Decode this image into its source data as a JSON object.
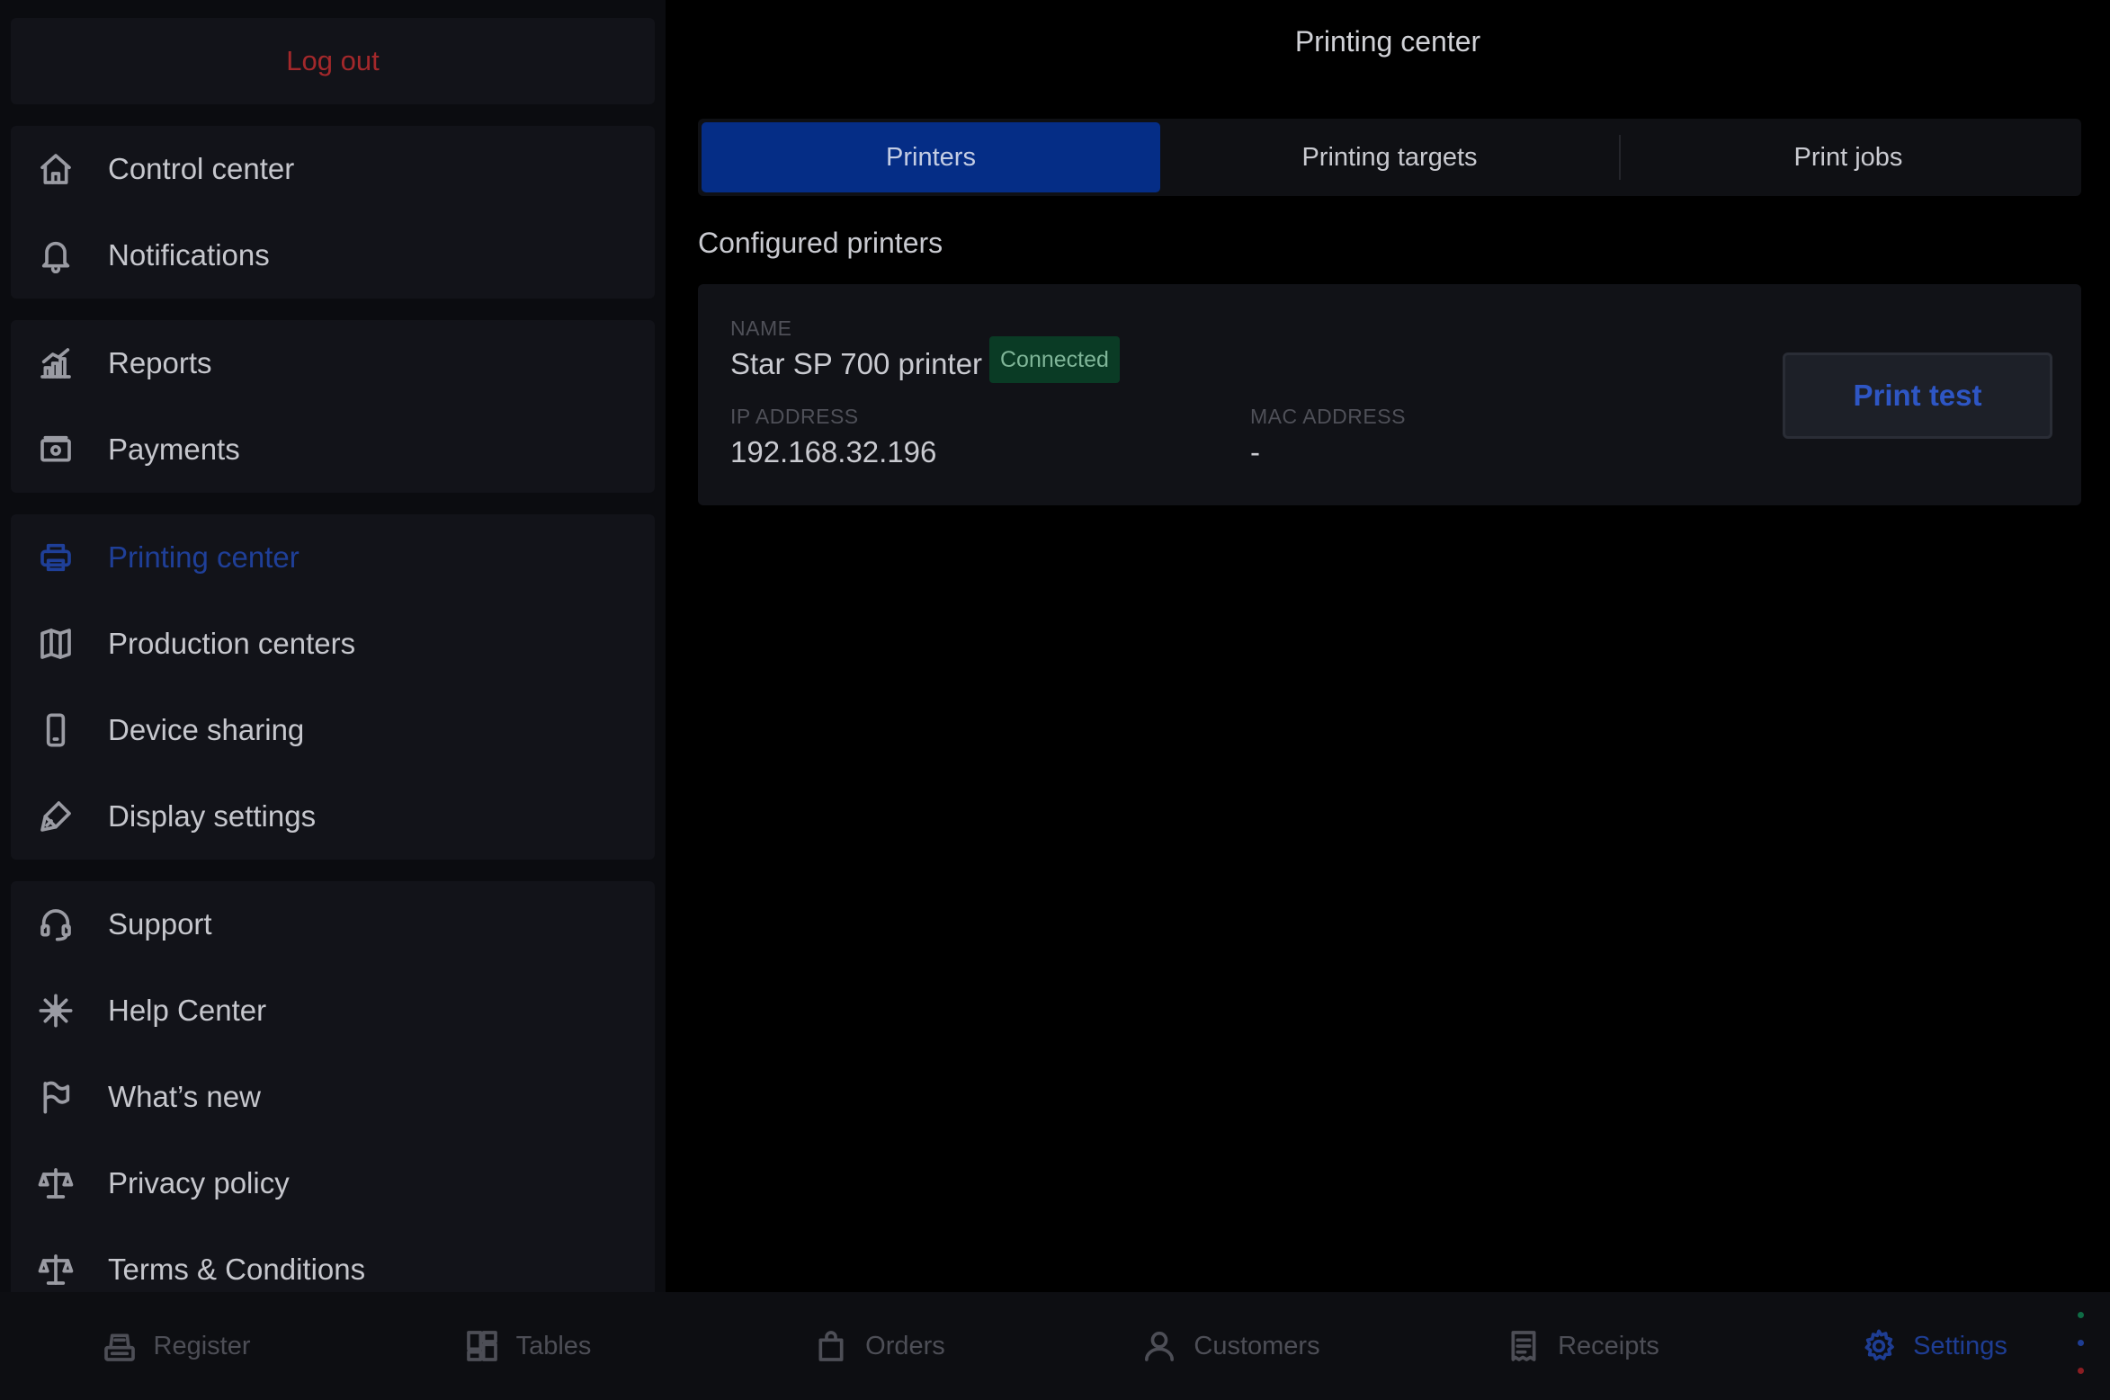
{
  "sidebar": {
    "logout_label": "Log out",
    "group1": [
      {
        "label": "Control center",
        "icon": "home-icon"
      },
      {
        "label": "Notifications",
        "icon": "bell-icon"
      }
    ],
    "group2": [
      {
        "label": "Reports",
        "icon": "chart-icon"
      },
      {
        "label": "Payments",
        "icon": "cash-icon"
      }
    ],
    "group3": [
      {
        "label": "Printing center",
        "icon": "printer-icon",
        "active": true
      },
      {
        "label": "Production centers",
        "icon": "map-icon"
      },
      {
        "label": "Device sharing",
        "icon": "phone-icon"
      },
      {
        "label": "Display settings",
        "icon": "brush-icon"
      }
    ],
    "group4": [
      {
        "label": "Support",
        "icon": "headset-icon"
      },
      {
        "label": "Help Center",
        "icon": "compass-icon"
      },
      {
        "label": "What’s new",
        "icon": "flag-icon"
      },
      {
        "label": "Privacy policy",
        "icon": "scale-icon"
      },
      {
        "label": "Terms & Conditions",
        "icon": "scale-icon"
      }
    ]
  },
  "main": {
    "title": "Printing center",
    "tabs": [
      {
        "label": "Printers",
        "active": true
      },
      {
        "label": "Printing targets"
      },
      {
        "label": "Print jobs"
      }
    ],
    "section_title": "Configured printers",
    "printer": {
      "name_label": "NAME",
      "name": "Star SP 700 printer",
      "status": "Connected",
      "ip_label": "IP ADDRESS",
      "ip": "192.168.32.196",
      "mac_label": "MAC ADDRESS",
      "mac": "-",
      "print_test_label": "Print test"
    }
  },
  "bottom_nav": [
    {
      "label": "Register",
      "icon": "register-icon"
    },
    {
      "label": "Tables",
      "icon": "tables-icon"
    },
    {
      "label": "Orders",
      "icon": "bag-icon"
    },
    {
      "label": "Customers",
      "icon": "user-icon"
    },
    {
      "label": "Receipts",
      "icon": "receipt-icon"
    },
    {
      "label": "Settings",
      "icon": "gear-icon",
      "active": true
    }
  ],
  "colors": {
    "accent": "#052d86",
    "logout": "#a3282b",
    "connected_bg": "#0a3b25",
    "status_dots": [
      "#0f6b45",
      "#1e3d93",
      "#8a1d22"
    ]
  }
}
